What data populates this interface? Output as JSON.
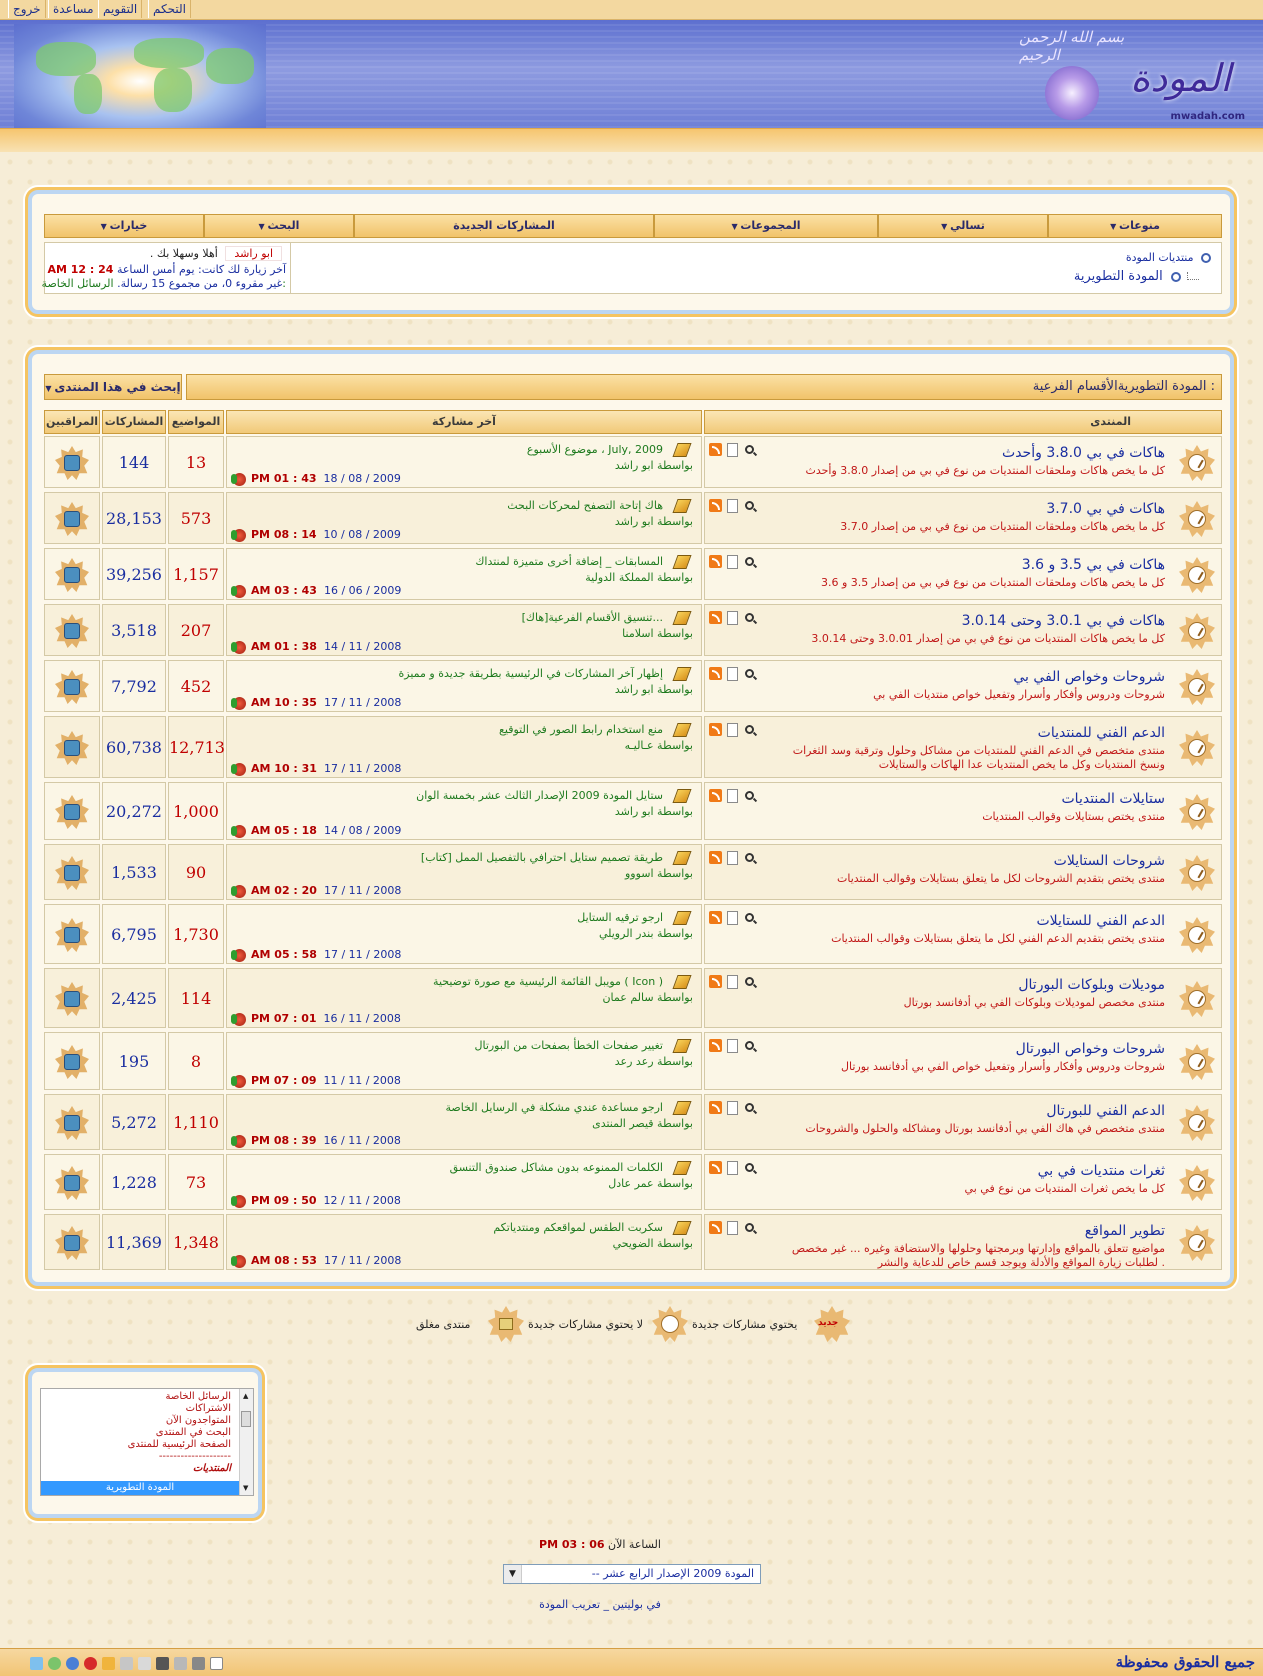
{
  "topbar": {
    "control": "التحكم",
    "calendar": "التقويم",
    "help": "مساعدة",
    "logout": "خروج"
  },
  "header": {
    "logo_text": "المودة",
    "bismillah": "بسم الله الرحمن الرحيم",
    "site": "mwadah.com"
  },
  "nav": {
    "misc": "منوعات",
    "fun": "تسالي",
    "groups": "المجموعات",
    "new_posts": "المشاركات الجديدة",
    "search": "البحث",
    "options": "خيارات"
  },
  "breadcrumb": {
    "root": "منتديات المودة",
    "current": "المودة التطويرية"
  },
  "welcome": {
    "greeting": "أهلا وسهلا بك",
    "username": "ابو راشد",
    "dot": ".",
    "last_visit": "آخر زيارة لك كانت: يوم أمس الساعة",
    "last_visit_time": "AM 12 : 24",
    "pm_label": "الرسائل الخاصة:",
    "pm_text": "غير مقروء 0، من مجموع 15 رسالة."
  },
  "subforums": {
    "title_prefix": "الأقسام الفرعية : ",
    "title": "المودة التطويرية",
    "search_button": "إبحث في هذا المنتدى",
    "col_forum": "المنتدى",
    "col_last": "آخر مشاركة",
    "col_topics": "المواضيع",
    "col_posts": "المشاركات",
    "col_mods": "المراقبين"
  },
  "forums": [
    {
      "name": "هاكات في بي 3.8.0 وأحدث",
      "desc": "كل ما يخص هاكات وملحقات المنتديات من نوع في بي من إصدار 3.8.0 وأحدث",
      "lp_title": "موضوع الأسبوع ، July, 2009",
      "lp_by": "بواسطة ابو راشد",
      "lp_date": "18 / 08 / 2009",
      "lp_time": "PM 01 : 43",
      "topics": "13",
      "posts": "144"
    },
    {
      "name": "هاكات في بي 3.7.0",
      "desc": "كل ما يخص هاكات وملحقات المنتديات من نوع في بي من إصدار 3.7.0",
      "lp_title": "هاك إتاحة التصفح لمحركات البحث",
      "lp_by": "بواسطة ابو راشد",
      "lp_date": "10 / 08 / 2009",
      "lp_time": "PM 08 : 14",
      "topics": "573",
      "posts": "28,153"
    },
    {
      "name": "هاكات في بي 3.5 و 3.6",
      "desc": "كل ما يخص هاكات وملحقات المنتديات من نوع في بي من إصدار 3.5 و 3.6",
      "lp_title": "المسابقات _ إضافة أخرى متميزة لمنتداك",
      "lp_by": "بواسطة المملكة الدولية",
      "lp_date": "16 / 06 / 2009",
      "lp_time": "AM 03 : 43",
      "topics": "1,157",
      "posts": "39,256"
    },
    {
      "name": "هاكات في بي 3.0.1 وحتى 3.0.14",
      "desc": "كل ما يخص هاكات المنتديات من نوع في بي من إصدار 3.0.01 وحتى 3.0.14",
      "lp_title": "[هاك]تنسيق الأقسام الفرعية...",
      "lp_by": "بواسطة اسلامنا",
      "lp_date": "14 / 11 / 2008",
      "lp_time": "AM 01 : 38",
      "topics": "207",
      "posts": "3,518"
    },
    {
      "name": "شروحات وخواص الفي بي",
      "desc": "شروحات ودروس وأفكار وأسرار وتفعيل خواص منتديات الفي بي",
      "lp_title": "إظهار آخر المشاركات في الرئيسية بطريقة جديدة و مميزة",
      "lp_by": "بواسطة ابو راشد",
      "lp_date": "17 / 11 / 2008",
      "lp_time": "AM 10 : 35",
      "topics": "452",
      "posts": "7,792"
    },
    {
      "name": "الدعم الفني للمنتديات",
      "desc": "منتدى متخصص في الدعم الفني للمنتديات من مشاكل وحلول وترقية وسد الثغرات ونسخ المنتديات وكل ما يخص المنتديات عدا الهاكات والستايلات",
      "lp_title": "منع استخدام رابط الصور في التوقيع",
      "lp_by": "بواسطة عـاليـه",
      "lp_date": "17 / 11 / 2008",
      "lp_time": "AM 10 : 31",
      "topics": "12,713",
      "posts": "60,738"
    },
    {
      "name": "ستايلات المنتديات",
      "desc": "منتدى يختص بستايلات وقوالب المنتديات",
      "lp_title": "ستايل المودة 2009 الإصدار الثالث عشر بخمسة الوان",
      "lp_by": "بواسطة ابو راشد",
      "lp_date": "14 / 08 / 2009",
      "lp_time": "AM 05 : 18",
      "topics": "1,000",
      "posts": "20,272"
    },
    {
      "name": "شروحات الستايلات",
      "desc": "منتدى يختص بتقديم الشروحات لكل ما يتعلق بستايلات وقوالب المنتديات",
      "lp_title": "[كتاب] طريقة تصميم ستايل احترافي بالتفصيل الممل",
      "lp_by": "بواسطة اسووو",
      "lp_date": "17 / 11 / 2008",
      "lp_time": "AM 02 : 20",
      "topics": "90",
      "posts": "1,533"
    },
    {
      "name": "الدعم الفني للستايلات",
      "desc": "منتدى يختص بتقديم الدعم الفني لكل ما يتعلق بستايلات وقوالب المنتديات",
      "lp_title": "ارجو ترقيه الستايل",
      "lp_by": "بواسطة بندر الرويلي",
      "lp_date": "17 / 11 / 2008",
      "lp_time": "AM 05 : 58",
      "topics": "1,730",
      "posts": "6,795"
    },
    {
      "name": "موديلات وبلوكات البورتال",
      "desc": "منتدى مخصص لموديلات وبلوكات الفي بي أدفانسد بورتال",
      "lp_title": "مويبل القائمة الرئيسية مع صورة توضيحية ( Icon )",
      "lp_by": "بواسطة سالم عمان",
      "lp_date": "16 / 11 / 2008",
      "lp_time": "PM 07 : 01",
      "topics": "114",
      "posts": "2,425"
    },
    {
      "name": "شروحات وخواص البورتال",
      "desc": "شروحات ودروس وأفكار وأسرار وتفعيل خواص الفي بي أدفانسد بورتال",
      "lp_title": "تغيير صفحات الخطأ بصفحات من البورتال",
      "lp_by": "بواسطة رعد رعد",
      "lp_date": "11 / 11 / 2008",
      "lp_time": "PM 07 : 09",
      "topics": "8",
      "posts": "195"
    },
    {
      "name": "الدعم الفني للبورتال",
      "desc": "منتدى متخصص في هاك الفي بي أدفانسد بورتال ومشاكله والحلول والشروحات",
      "lp_title": "ارجو مساعدة عندي مشكلة في الرسايل الخاصة",
      "lp_by": "بواسطة قيصر المنتدى",
      "lp_date": "16 / 11 / 2008",
      "lp_time": "PM 08 : 39",
      "topics": "1,110",
      "posts": "5,272"
    },
    {
      "name": "ثغرات منتديات في بي",
      "desc": "كل ما يخص ثغرات المنتديات من نوع في بي",
      "lp_title": "الكلمات الممنوعه بدون مشاكل صندوق التنسق",
      "lp_by": "بواسطة عمر عادل",
      "lp_date": "12 / 11 / 2008",
      "lp_time": "PM 09 : 50",
      "topics": "73",
      "posts": "1,228"
    },
    {
      "name": "تطوير المواقع",
      "desc": "مواضيع تتعلق بالمواقع وإدارتها وبرمجتها وحلولها والاستضافة وغيره ... غير مخصص لطلبات زيارة المواقع والأدلة ويوجد قسم خاص للدعاية والنشر .",
      "lp_title": "سكربت الطقس لمواقعكم ومنتدياتكم",
      "lp_by": "بواسطة الضويحي",
      "lp_date": "17 / 11 / 2008",
      "lp_time": "AM 08 : 53",
      "topics": "1,348",
      "posts": "11,369"
    }
  ],
  "legend": {
    "new_posts": "يحتوي مشاركات جديدة",
    "no_new": "لا يحتوي مشاركات جديدة",
    "closed": "منتدى مغلق",
    "new_badge": "جديد"
  },
  "jumplist": {
    "items": [
      "الرسائل الخاصة",
      "الاشتراكات",
      "المتواجدون الآن",
      "البحث في المنتدى",
      "الصفحة الرئيسية للمنتدى",
      "--------------------",
      "المنتديات"
    ],
    "selected": "المودة التطويرية"
  },
  "bottom": {
    "time_label": "الساعة الآن",
    "time_value": "PM 03 : 06",
    "style_select": "-- المودة 2009 الإصدار الرابع عشر",
    "credit": "في بوليتين _ تعريب المودة"
  },
  "footer": {
    "rights": "جميع الحقوق محفوظة"
  },
  "colors": {
    "accent": "#1a2ea0",
    "topics": "#c00000",
    "last_post": "#1e7a1e",
    "desc": "#c01818",
    "gold": "#f1c36a"
  }
}
